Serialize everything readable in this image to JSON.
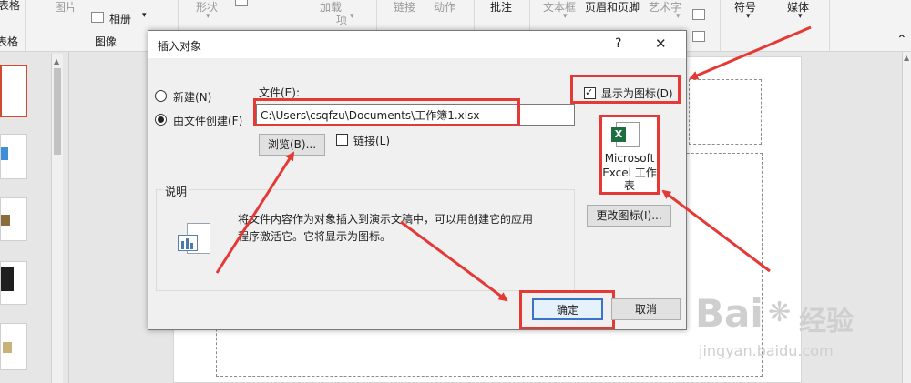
{
  "ribbon": {
    "group_labels": {
      "table": "表格",
      "images": "图像"
    },
    "items": {
      "table": "表格",
      "pictures": "图片",
      "album": "相册",
      "shapes": "形状",
      "addins_1": "加载",
      "addins_2": "项",
      "link": "链接",
      "action": "动作",
      "comment": "批注",
      "textbox": "文本框",
      "header_footer": "页眉和页脚",
      "wordart": "艺术字",
      "symbols": "符号",
      "media": "媒体"
    }
  },
  "dialog": {
    "title": "插入对象",
    "help": "?",
    "close": "✕",
    "radio_new": "新建(N)",
    "radio_from_file": "由文件创建(F)",
    "file_label": "文件(E):",
    "file_path": "C:\\Users\\csqfzu\\Documents\\工作簿1.xlsx",
    "browse": "浏览(B)...",
    "link": "链接(L)",
    "display_as_icon": "显示为图标(D)",
    "icon_caption_1": "Microsoft",
    "icon_caption_2": "Excel 工作",
    "icon_caption_3": "表",
    "change_icon": "更改图标(I)...",
    "description_title": "说明",
    "description_1": "将文件内容作为对象插入到演示文稿中，可以用创建它的应用",
    "description_2": "程序激活它。它将显示为图标。",
    "ok": "确定",
    "cancel": "取消",
    "state": {
      "selected_option": "from_file",
      "link_checked": false,
      "display_as_icon_checked": true
    }
  },
  "watermark": {
    "brand": "Bai",
    "brand_tail": "经验",
    "url": "jingyan.baidu.com"
  },
  "colors": {
    "annotation": "#e53935",
    "excel_green": "#1d6f42",
    "dialog_bg": "#f0f0f0"
  }
}
